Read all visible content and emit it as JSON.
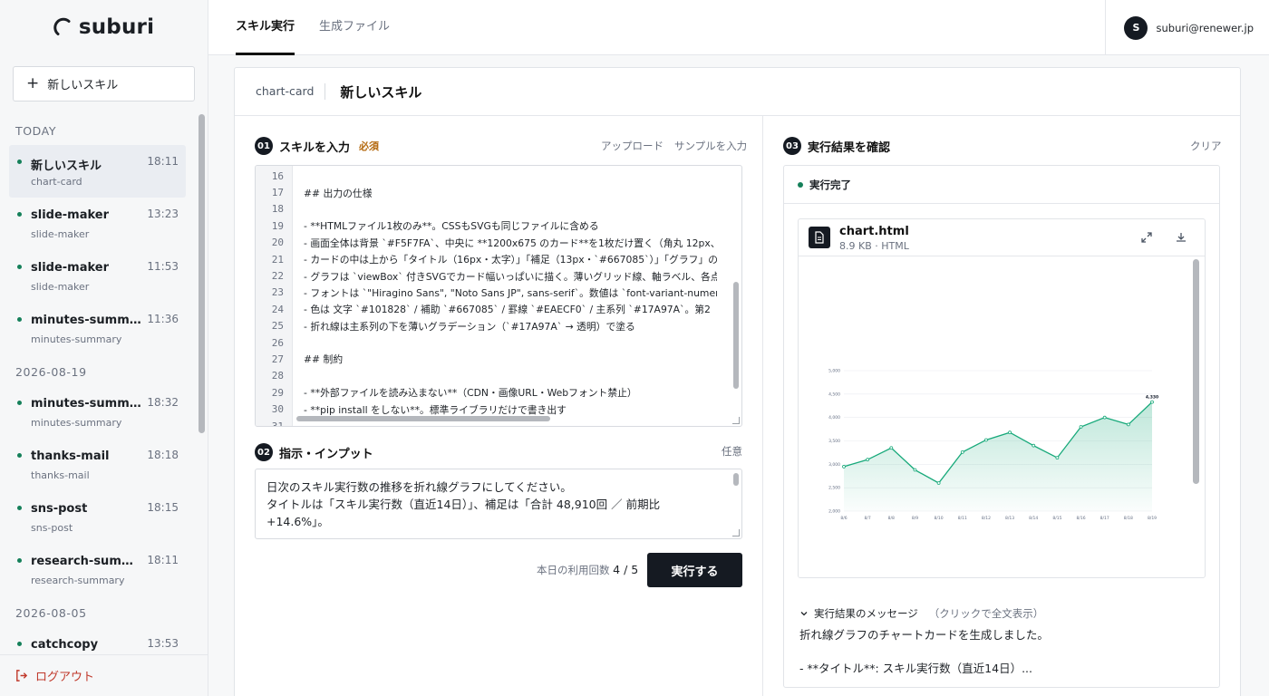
{
  "app": {
    "name": "suburi"
  },
  "sidebar": {
    "new_skill_label": "新しいスキル",
    "groups": [
      {
        "label": "TODAY",
        "items": [
          {
            "title": "新しいスキル",
            "sub": "chart-card",
            "time": "18:11",
            "active": true
          },
          {
            "title": "slide-maker",
            "sub": "slide-maker",
            "time": "13:23"
          },
          {
            "title": "slide-maker",
            "sub": "slide-maker",
            "time": "11:53"
          },
          {
            "title": "minutes-summary",
            "sub": "minutes-summary",
            "time": "11:36"
          }
        ]
      },
      {
        "label": "2026-08-19",
        "items": [
          {
            "title": "minutes-summary",
            "sub": "minutes-summary",
            "time": "18:32"
          },
          {
            "title": "thanks-mail",
            "sub": "thanks-mail",
            "time": "18:18"
          },
          {
            "title": "sns-post",
            "sub": "sns-post",
            "time": "18:15"
          },
          {
            "title": "research-summ...",
            "sub": "research-summary",
            "time": "18:11"
          }
        ]
      },
      {
        "label": "2026-08-05",
        "items": [
          {
            "title": "catchcopy",
            "sub": "",
            "time": "13:53"
          }
        ]
      }
    ],
    "logout_label": "ログアウト"
  },
  "topbar": {
    "tabs": [
      {
        "label": "スキル実行",
        "active": true
      },
      {
        "label": "生成ファイル",
        "active": false
      }
    ],
    "avatar_letter": "S",
    "email": "suburi@renewer.jp"
  },
  "card": {
    "skill_id": "chart-card",
    "title": "新しいスキル"
  },
  "skill_input": {
    "number": "01",
    "title": "スキルを入力",
    "required": "必須",
    "upload": "アップロード",
    "sample": "サンプルを入力",
    "lines": [
      {
        "n": "16",
        "text": ""
      },
      {
        "n": "17",
        "text": "## 出力の仕様"
      },
      {
        "n": "18",
        "text": ""
      },
      {
        "n": "19",
        "text": "- **HTMLファイル1枚のみ**。CSSもSVGも同じファイルに含める"
      },
      {
        "n": "20",
        "text": "- 画面全体は背景 `#F5F7FA`、中央に **1200x675 のカード**を1枚だけ置く（角丸 12px、"
      },
      {
        "n": "21",
        "text": "- カードの中は上から「タイトル（16px・太字）」「補足（13px・`#667085`）」「グラフ」の"
      },
      {
        "n": "22",
        "text": "- グラフは `viewBox` 付きSVGでカード幅いっぱいに描く。薄いグリッド線、軸ラベル、各点"
      },
      {
        "n": "23",
        "text": "- フォントは `\"Hiragino Sans\", \"Noto Sans JP\", sans-serif`。数値は `font-variant-numer"
      },
      {
        "n": "24",
        "text": "- 色は 文字 `#101828` / 補助 `#667085` / 罫線 `#EAECF0` / 主系列 `#17A97A`。第2"
      },
      {
        "n": "25",
        "text": "- 折れ線は主系列の下を薄いグラデーション（`#17A97A` → 透明）で塗る"
      },
      {
        "n": "26",
        "text": ""
      },
      {
        "n": "27",
        "text": "## 制約"
      },
      {
        "n": "28",
        "text": ""
      },
      {
        "n": "29",
        "text": "- **外部ファイルを読み込まない**（CDN・画像URL・Webフォント禁止）"
      },
      {
        "n": "30",
        "text": "- **pip install をしない**。標準ライブラリだけで書き出す"
      },
      {
        "n": "31",
        "text": ""
      }
    ]
  },
  "instruction": {
    "number": "02",
    "title": "指示・インプット",
    "optional": "任意",
    "lines": [
      "日次のスキル実行数の推移を折れ線グラフにしてください。",
      "タイトルは「スキル実行数（直近14日）」、補足は「合計 48,910回 ／ 前期比",
      "+14.6%」。"
    ]
  },
  "usage": {
    "label": "本日の利用回数",
    "value": "4 / 5"
  },
  "run_label": "実行する",
  "result": {
    "number": "03",
    "title": "実行結果を確認",
    "clear": "クリア",
    "status": "実行完了",
    "file_name": "chart.html",
    "file_meta": "8.9 KB · HTML",
    "message_label": "実行結果のメッセージ",
    "message_hint": "（クリックで全文表示）",
    "message_lines": [
      "折れ線グラフのチャートカードを生成しました。",
      "",
      "- **タイトル**: スキル実行数（直近14日）..."
    ]
  },
  "chart_data": {
    "type": "area",
    "x": [
      "8/6",
      "8/7",
      "8/8",
      "8/9",
      "8/10",
      "8/11",
      "8/12",
      "8/13",
      "8/14",
      "8/15",
      "8/16",
      "8/17",
      "8/18",
      "8/19"
    ],
    "series": [
      {
        "values": [
          2950,
          3100,
          3350,
          2880,
          2600,
          3260,
          3520,
          3680,
          3400,
          3140,
          3800,
          4000,
          3850,
          4330
        ]
      }
    ],
    "yticks": [
      "5,000",
      "4,500",
      "4,000",
      "3,500",
      "3,000",
      "2,500",
      "2,000"
    ],
    "ylim": [
      2000,
      5000
    ],
    "last_label": "4,330",
    "color": "#17A97A",
    "grid": true
  }
}
